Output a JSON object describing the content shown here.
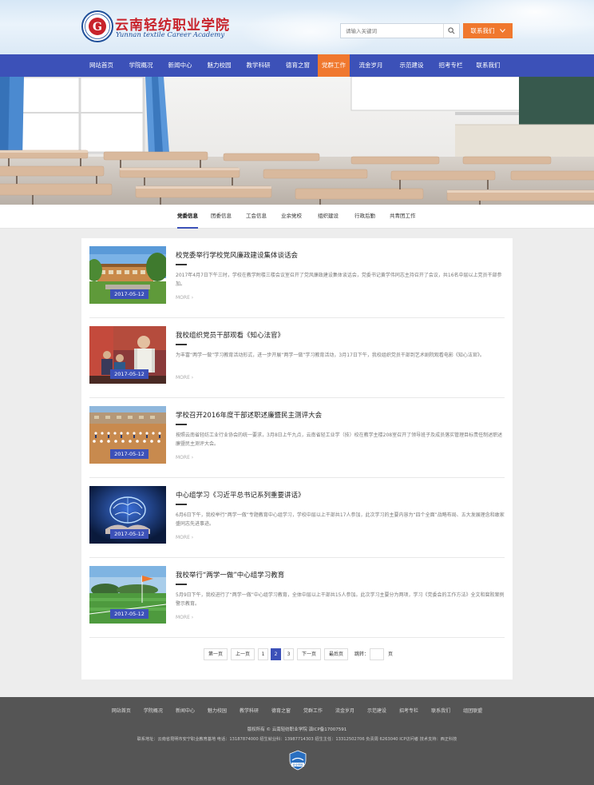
{
  "header": {
    "logo_cn": "云南轻纺职业学院",
    "logo_en": "Yunnan textile Career Academy",
    "logo_emblem_letter": "G",
    "search_placeholder": "请输入关键词",
    "contact_label": "联系我们",
    "accent": "#f0782e"
  },
  "nav": {
    "items": [
      {
        "label": "网站首页"
      },
      {
        "label": "学院概况"
      },
      {
        "label": "新闻中心"
      },
      {
        "label": "魅力校园"
      },
      {
        "label": "教学科研"
      },
      {
        "label": "德育之窗"
      },
      {
        "label": "党群工作"
      },
      {
        "label": "流金岁月"
      },
      {
        "label": "示范建设"
      },
      {
        "label": "招考专栏"
      },
      {
        "label": "联系我们"
      }
    ],
    "active_index": 6,
    "bg_color": "#3c51b8"
  },
  "subnav": {
    "items": [
      {
        "label": "党委信息"
      },
      {
        "label": "团委信息"
      },
      {
        "label": "工会信息"
      },
      {
        "label": "业余党校"
      },
      {
        "label": "组织建设"
      },
      {
        "label": "行政后勤"
      },
      {
        "label": "共青团工作"
      }
    ],
    "active_index": 0
  },
  "articles": [
    {
      "title": "校党委举行学校党风廉政建设集体谈话会",
      "summary": "2017年4月7日下午三时，学校在教学附楼三楼会议室召开了党风廉政建设集体谈话会，党委书记黄学伟同志主持召开了会议，共16名中层以上党员干部参加。",
      "date": "2017-05-12",
      "more": "MORE"
    },
    {
      "title": "我校组织党员干部观看《知心法官》",
      "summary": "为丰富“两学一做”学习教育活动形式，进一步开展“两学一做”学习教育活动，3月17日下午，我校组织党员干部到艺术剧院观看电影《知心法官》。",
      "date": "2017-05-12",
      "more": "MORE"
    },
    {
      "title": "学校召开2016年度干部述职述廉暨民主测评大会",
      "summary": "按照云南省轻纺工业行业协会的统一要求，3月8日上午九点，云南省轻工业学（技）校在教学主楼208室召开了领导班子及成员落实管理目标责任制述职述廉暨民主测评大会。",
      "date": "2017-05-12",
      "more": "MORE"
    },
    {
      "title": "中心组学习《习近平总书记系列重要讲话》",
      "summary": "6月6日下午，我校举行“两学一做”专题教育中心组学习，学校中层以上干部共17人参加，此次学习的主要内容为“四个全面”战略布局、五大发展理念和敢家盛同志先进事迹。",
      "date": "2017-05-12",
      "more": "MORE"
    },
    {
      "title": "我校举行“两学一做”中心组学习教育",
      "summary": "5月9日下午，我校进行了“两学一做”中心组学习教育，全体中层以上干部共15人参加。此次学习主要分为两项，学习《党委会的工作方法》全文和腐败案例警示教育。",
      "date": "2017-05-12",
      "more": "MORE"
    }
  ],
  "pager": {
    "first": "第一页",
    "prev": "上一页",
    "pages": [
      "1",
      "2",
      "3"
    ],
    "current_index": 1,
    "next": "下一页",
    "last": "最后页",
    "jump_label": "跳转：",
    "page_unit": "页"
  },
  "footer": {
    "links": [
      "网站首页",
      "学院概况",
      "新闻中心",
      "魅力校园",
      "教学科研",
      "德育之窗",
      "党群工作",
      "流金岁月",
      "示范建设",
      "招考专栏",
      "联系我们",
      "组团联盟"
    ],
    "copyright": "版权所有 © 云南轻纺职业学院 滇ICP备17007591",
    "address": "联系地址：云南省昆明市安宁职业教育基地 电话：13187874000  招生就业科：13987714303  招生主任：13312502706 负责周  6263040  ICP访问者  技术支持：西正科技",
    "badge_label": "安全举报"
  }
}
